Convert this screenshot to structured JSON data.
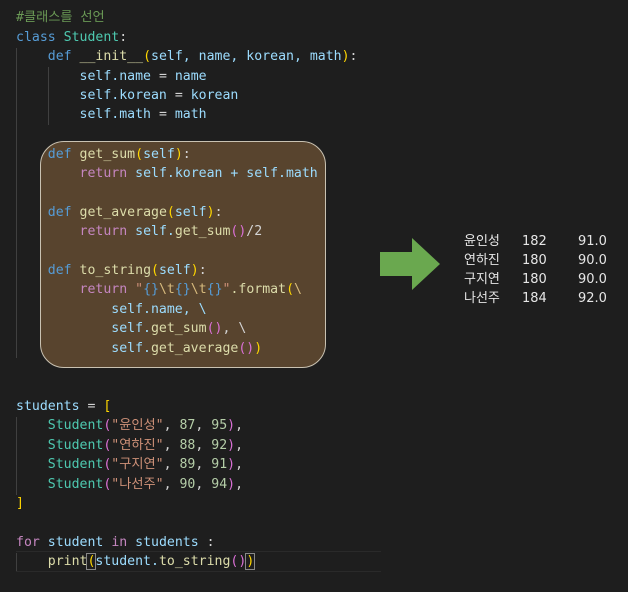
{
  "editor": {
    "comment": "#클래스를 선언",
    "class_kw": "class",
    "class_name": "Student",
    "init": {
      "def": "def",
      "name": "__init__",
      "params": "self, name, korean, math",
      "body": [
        {
          "lhs": "self.name",
          "rhs": "name"
        },
        {
          "lhs": "self.korean",
          "rhs": "korean"
        },
        {
          "lhs": "self.math",
          "rhs": "math"
        }
      ]
    },
    "get_sum": {
      "def": "def",
      "name": "get_sum",
      "param": "self",
      "ret": "return",
      "expr": "self.korean + self.math"
    },
    "get_average": {
      "def": "def",
      "name": "get_average",
      "param": "self",
      "ret": "return",
      "prefix": "self.",
      "call": "get_sum",
      "suffix": "/2"
    },
    "to_string": {
      "def": "def",
      "name": "to_string",
      "param": "self",
      "ret": "return",
      "str_q1": "\"",
      "s1": "{}",
      "e1": "\\t",
      "s2": "{}",
      "e2": "\\t",
      "s3": "{}",
      "str_q2": "\"",
      "format": ".format",
      "cont": "\\",
      "arg1": "self.name, \\",
      "arg2_prefix": "self.",
      "arg2_call": "get_sum",
      "arg2_suffix": ", \\",
      "arg3_prefix": "self.",
      "arg3_call": "get_average"
    },
    "students_var": "students",
    "students": [
      {
        "cls": "Student",
        "name": "\"윤인성\"",
        "korean": "87",
        "math": "95"
      },
      {
        "cls": "Student",
        "name": "\"연하진\"",
        "korean": "88",
        "math": "92"
      },
      {
        "cls": "Student",
        "name": "\"구지연\"",
        "korean": "89",
        "math": "91"
      },
      {
        "cls": "Student",
        "name": "\"나선주\"",
        "korean": "90",
        "math": "94"
      }
    ],
    "for_kw": "for",
    "loop_var": "student",
    "in_kw": "in",
    "iter": "students",
    "print_fn": "print",
    "loop_call_obj": "student.",
    "loop_call_fn": "to_string"
  },
  "output": {
    "rows": [
      {
        "name": "윤인성",
        "sum": "182",
        "avg": "91.0"
      },
      {
        "name": "연하진",
        "sum": "180",
        "avg": "90.0"
      },
      {
        "name": "구지연",
        "sum": "180",
        "avg": "90.0"
      },
      {
        "name": "나선주",
        "sum": "184",
        "avg": "92.0"
      }
    ]
  },
  "colors": {
    "background": "#1e1e1e",
    "highlight_box": "#58442e",
    "arrow": "#6aa84f"
  }
}
